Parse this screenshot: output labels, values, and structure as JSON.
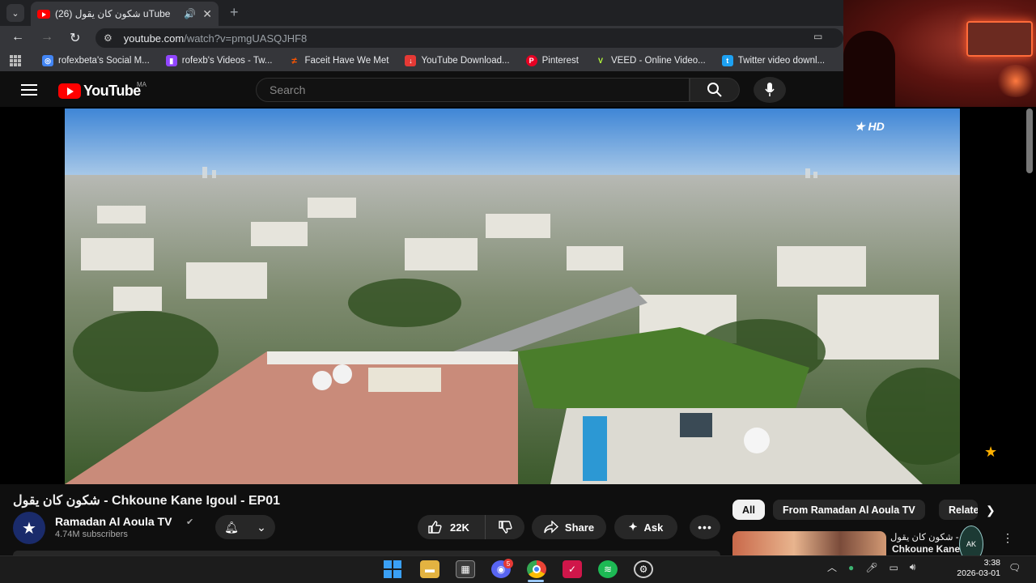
{
  "browser": {
    "tab_title": "(26) شكون كان يقول uTube",
    "tab_speaker": "🔊",
    "tab_close": "✕",
    "new_tab": "+",
    "url_domain": "youtube.com",
    "url_path": "/watch?v=pmgUASQJHF8",
    "bookmarks": [
      {
        "label": "rofexbeta's Social M...",
        "icon_color": "#4285f4",
        "icon": "search-icon"
      },
      {
        "label": "rofexb's Videos - Tw...",
        "icon_color": "#9146ff",
        "icon": "twitch-icon"
      },
      {
        "label": "Faceit Have We Met",
        "icon_color": "#ff5500",
        "icon": "faceit-icon"
      },
      {
        "label": "YouTube Download...",
        "icon_color": "#e53935",
        "icon": "download-icon"
      },
      {
        "label": "Pinterest",
        "icon_color": "#e60023",
        "icon": "pinterest-icon"
      },
      {
        "label": "VEED - Online Video...",
        "icon_color": "#1a1a1a",
        "icon": "veed-icon"
      },
      {
        "label": "Twitter video downl...",
        "icon_color": "#1da1f2",
        "icon": "twitter-icon"
      }
    ]
  },
  "youtube": {
    "logo_text": "YouTube",
    "country_code": "MA",
    "search_placeholder": "Search"
  },
  "video": {
    "title": "شكون كان يقول - Chkoune Kane Igoul - EP01",
    "channel": "Ramadan Al Aoula TV",
    "subscribers": "4.74M subscribers",
    "likes": "22K",
    "share_label": "Share",
    "ask_label": "Ask",
    "watermark": "HD"
  },
  "chips": {
    "all": "All",
    "from": "From Ramadan Al Aoula TV",
    "related": "Related"
  },
  "recommendation": {
    "line1": "شكون كان يقول -",
    "line2": "Chkoune Kane Igoul"
  },
  "taskbar": {
    "time": "3:38",
    "date": "2026-03-01",
    "discord_badge": "5"
  },
  "colors": {
    "accent": "#ff0000",
    "bg": "#0f0f0f"
  }
}
